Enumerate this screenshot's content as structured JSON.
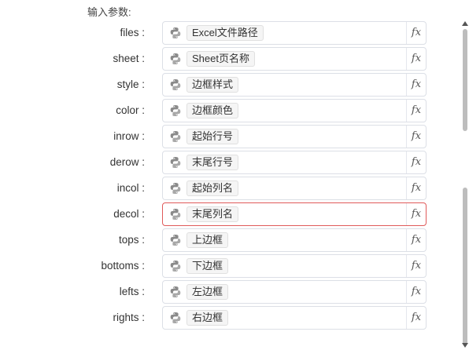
{
  "section_title": "输入参数:",
  "params": [
    {
      "label": "files :",
      "value": "Excel文件路径",
      "error": false
    },
    {
      "label": "sheet :",
      "value": "Sheet页名称",
      "error": false
    },
    {
      "label": "style :",
      "value": "边框样式",
      "error": false
    },
    {
      "label": "color :",
      "value": "边框颜色",
      "error": false
    },
    {
      "label": "inrow :",
      "value": "起始行号",
      "error": false
    },
    {
      "label": "derow :",
      "value": "末尾行号",
      "error": false
    },
    {
      "label": "incol :",
      "value": "起始列名",
      "error": false
    },
    {
      "label": "decol :",
      "value": "末尾列名",
      "error": true
    },
    {
      "label": "tops :",
      "value": "上边框",
      "error": false
    },
    {
      "label": "bottoms :",
      "value": "下边框",
      "error": false
    },
    {
      "label": "lefts :",
      "value": "左边框",
      "error": false
    },
    {
      "label": "rights :",
      "value": "右边框",
      "error": false
    }
  ],
  "fx_label": "fx",
  "icons": {
    "field": "python-icon",
    "expression": "fx-icon"
  },
  "colors": {
    "error_border": "#e05a5a",
    "field_border": "#dcdfe6",
    "tag_bg": "#f5f5f5"
  }
}
